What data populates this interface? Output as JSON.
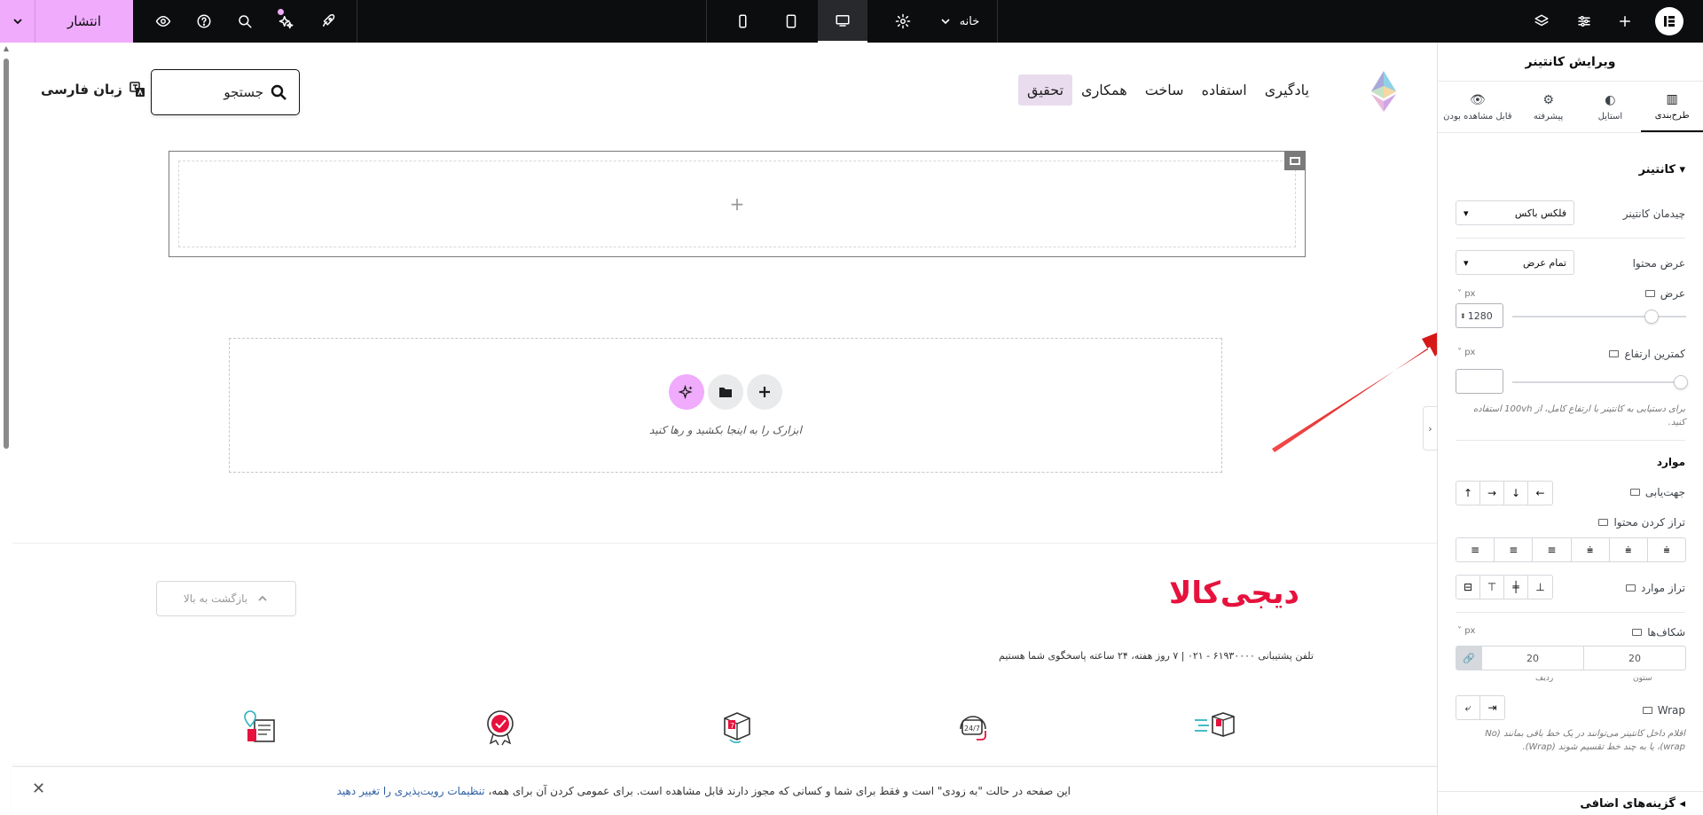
{
  "topbar": {
    "publish_label": "انتشار",
    "page_label": "خانه",
    "icons": [
      "chevron-down-icon",
      "eye-icon",
      "help-icon",
      "search-icon",
      "sparkle-icon",
      "rocket-icon",
      "monitor-icon",
      "tablet-icon",
      "mobile-icon",
      "gear-icon",
      "layers-icon",
      "sliders-icon",
      "plus-icon",
      "elementor-logo"
    ]
  },
  "site": {
    "lang_label": "زبان فارسی",
    "search_placeholder": "جستجو",
    "nav": [
      "یادگیری",
      "استفاده",
      "ساخت",
      "همکاری",
      "تحقیق"
    ],
    "active_nav": "تحقیق"
  },
  "canvas": {
    "container_add": "+",
    "dropzone_text": "ابزارک را به اینجا بکشید و رها کنید"
  },
  "footer": {
    "back_to_top": "بازگشت به بالا",
    "brand": "دیجی‌کالا",
    "support": "تلفن پشتیبانی ۶۱۹۳۰۰۰۰ - ۰۲۱ | ۷ روز هفته، ۲۴ ساعته پاسخگوی شما هستیم"
  },
  "notice": {
    "text": "این صفحه در حالت \"به زودی\" است و فقط برای شما و کسانی که مجوز دارند قابل مشاهده است. برای عمومی کردن آن برای همه، ",
    "link": "تنظیمات رویت‌پذیری را تغییر دهید"
  },
  "panel": {
    "title": "ویرایش کانتینر",
    "tabs": [
      "طرح‌بندی",
      "استایل",
      "پیشرفته",
      "قابل مشاهده بودن"
    ],
    "section_container": "کانتینر",
    "layout_label": "چیدمان کانتینر",
    "layout_value": "فلکس باکس",
    "content_width_label": "عرض محتوا",
    "content_width_value": "تمام عرض",
    "width_label": "عرض",
    "width_unit": "px",
    "width_value": "1280",
    "width_fraction": 0.8,
    "min_height_label": "کمترین ارتفاع",
    "min_height_unit": "px",
    "min_height_hint": "برای دستیابی به کانتینر با ارتفاع کامل، از 100vh استفاده کنید.",
    "section_items": "موارد",
    "direction_label": "جهت‌یابی",
    "justify_label": "تراز کردن محتوا",
    "align_label": "تراز موارد",
    "gaps_label": "شکاف‌ها",
    "gaps_unit": "px",
    "gap_column_value": "20",
    "gap_row_value": "20",
    "gap_column_label": "ستون",
    "gap_row_label": "ردیف",
    "wrap_label": "Wrap",
    "wrap_hint": "اقلام داخل کانتینر می‌توانند در یک خط باقی بمانند (No wrap)، یا به چند خط تقسیم شوند (Wrap).",
    "section_extra": "گزینه‌های اضافی"
  },
  "colors": {
    "publish_bg": "#f0abfc",
    "topbar_bg": "#0c0d0e",
    "brand_red": "#e6123d",
    "arrow_red": "#e01b1b"
  }
}
